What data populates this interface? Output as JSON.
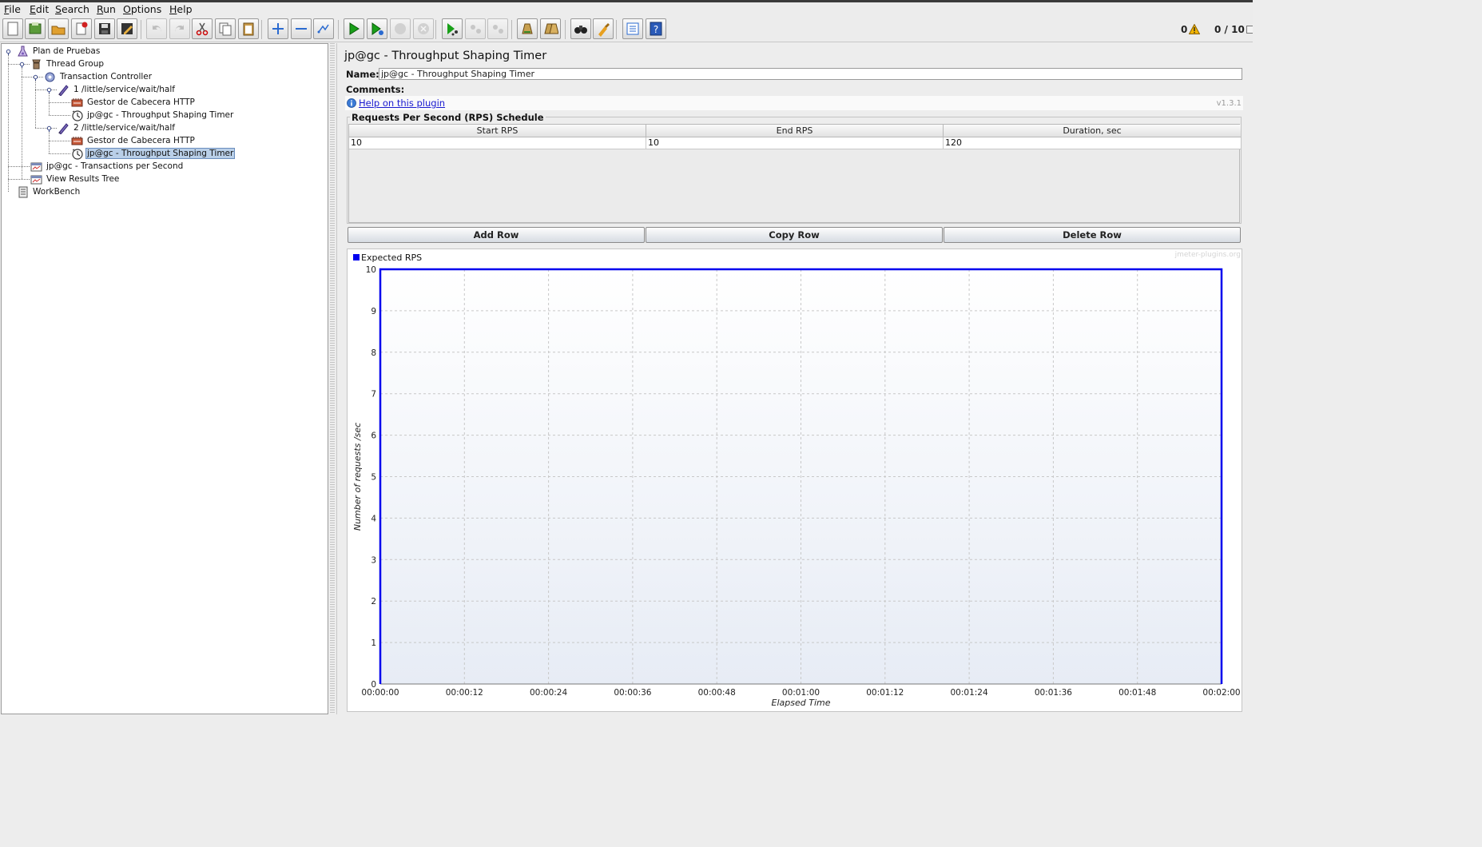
{
  "menu": [
    "File",
    "Edit",
    "Search",
    "Run",
    "Options",
    "Help"
  ],
  "menu_mnemonic": [
    "F",
    "E",
    "S",
    "R",
    "O",
    "H"
  ],
  "toolbar": {
    "buttons": [
      "new-icon",
      "templates-icon",
      "open-icon",
      "close-icon",
      "save-icon",
      "save-as-icon",
      "undo-icon",
      "redo-icon",
      "cut-icon",
      "copy-icon",
      "paste-icon",
      "expand-icon",
      "collapse-icon",
      "toggle-icon",
      "start-icon",
      "start-no-pause-icon",
      "stop-icon",
      "shutdown-icon",
      "remote-start-icon",
      "remote-stop-icon",
      "remote-shutdown-icon",
      "clear-icon",
      "clear-all-icon",
      "search-icon",
      "reset-search-icon",
      "function-helper-icon",
      "help-icon"
    ],
    "errors_count": "0",
    "threads": "0 / 10"
  },
  "tree": {
    "items": [
      {
        "label": "Plan de Pruebas",
        "icon": "test-plan-icon"
      },
      {
        "label": "Thread Group",
        "icon": "thread-group-icon"
      },
      {
        "label": "Transaction Controller",
        "icon": "controller-icon"
      },
      {
        "label": "1 /little/service/wait/half",
        "icon": "sampler-icon"
      },
      {
        "label": "Gestor de Cabecera HTTP",
        "icon": "config-icon"
      },
      {
        "label": "jp@gc - Throughput Shaping Timer",
        "icon": "timer-icon"
      },
      {
        "label": "2 /little/service/wait/half",
        "icon": "sampler-icon"
      },
      {
        "label": "Gestor de Cabecera HTTP",
        "icon": "config-icon"
      },
      {
        "label": "jp@gc - Throughput Shaping Timer",
        "icon": "timer-icon",
        "selected": true
      },
      {
        "label": "jp@gc - Transactions per Second",
        "icon": "listener-icon"
      },
      {
        "label": "View Results Tree",
        "icon": "listener-icon"
      },
      {
        "label": "WorkBench",
        "icon": "workbench-icon"
      }
    ]
  },
  "panel": {
    "title": "jp@gc - Throughput Shaping Timer",
    "name_label": "Name:",
    "name_value": "jp@gc - Throughput Shaping Timer",
    "comments_label": "Comments:",
    "help_link": "Help on this plugin",
    "version": "v1.3.1"
  },
  "schedule": {
    "title": "Requests Per Second (RPS) Schedule",
    "columns": [
      "Start RPS",
      "End RPS",
      "Duration, sec"
    ],
    "rows": [
      [
        "10",
        "10",
        "120"
      ]
    ],
    "buttons": [
      "Add Row",
      "Copy Row",
      "Delete Row"
    ]
  },
  "chart_data": {
    "type": "line",
    "legend": [
      "Expected RPS"
    ],
    "legend_position": "top-left",
    "watermark": "jmeter-plugins.org",
    "xlabel": "Elapsed Time",
    "ylabel": "Number of requests /sec",
    "x_ticks": [
      "00:00:00",
      "00:00:12",
      "00:00:24",
      "00:00:36",
      "00:00:48",
      "00:01:00",
      "00:01:12",
      "00:01:24",
      "00:01:36",
      "00:01:48",
      "00:02:00"
    ],
    "y_ticks": [
      "0",
      "1",
      "2",
      "3",
      "4",
      "5",
      "6",
      "7",
      "8",
      "9",
      "10"
    ],
    "xlim_seconds": [
      0,
      120
    ],
    "ylim": [
      0,
      10
    ],
    "grid": true,
    "series": [
      {
        "name": "Expected RPS",
        "color": "#0000ee",
        "x_seconds": [
          0,
          0,
          120,
          120
        ],
        "y": [
          0,
          10,
          10,
          0
        ]
      }
    ]
  }
}
